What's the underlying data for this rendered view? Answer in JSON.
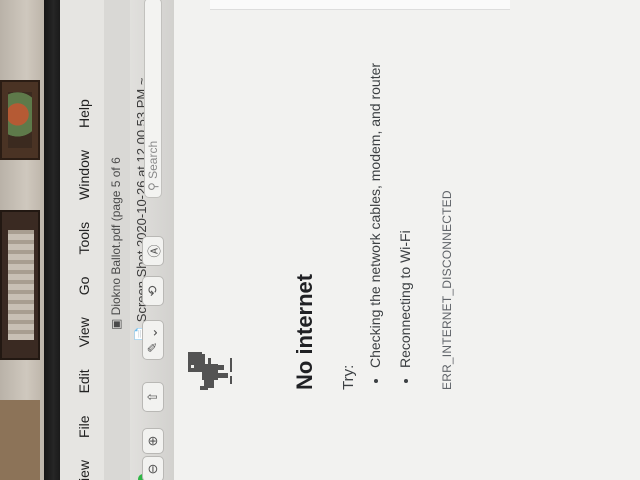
{
  "menu": {
    "items": [
      "view",
      "File",
      "Edit",
      "View",
      "Go",
      "Tools",
      "Window",
      "Help"
    ]
  },
  "window": {
    "tab_title": "Diokno Ballot.pdf (page 5 of 6",
    "document_title": "Screen Shot 2020-10-26 at 12.00.53 PM ~",
    "search_placeholder": "Search"
  },
  "toolbar": {
    "zoom_out_icon": "magnifier-minus-icon",
    "zoom_in_icon": "magnifier-plus-icon",
    "share_icon": "share-icon",
    "markup_icon": "pen-icon",
    "rotate_icon": "rotate-icon",
    "annotate_icon": "markup-circle-icon"
  },
  "error_page": {
    "icon": "dino-icon",
    "heading": "No internet",
    "try_label": "Try:",
    "tips": [
      "Checking the network cables, modem, and router",
      "Reconnecting to Wi-Fi"
    ],
    "error_code": "ERR_INTERNET_DISCONNECTED"
  },
  "colors": {
    "traffic_green": "#2fb646",
    "heading_text": "#202124"
  }
}
